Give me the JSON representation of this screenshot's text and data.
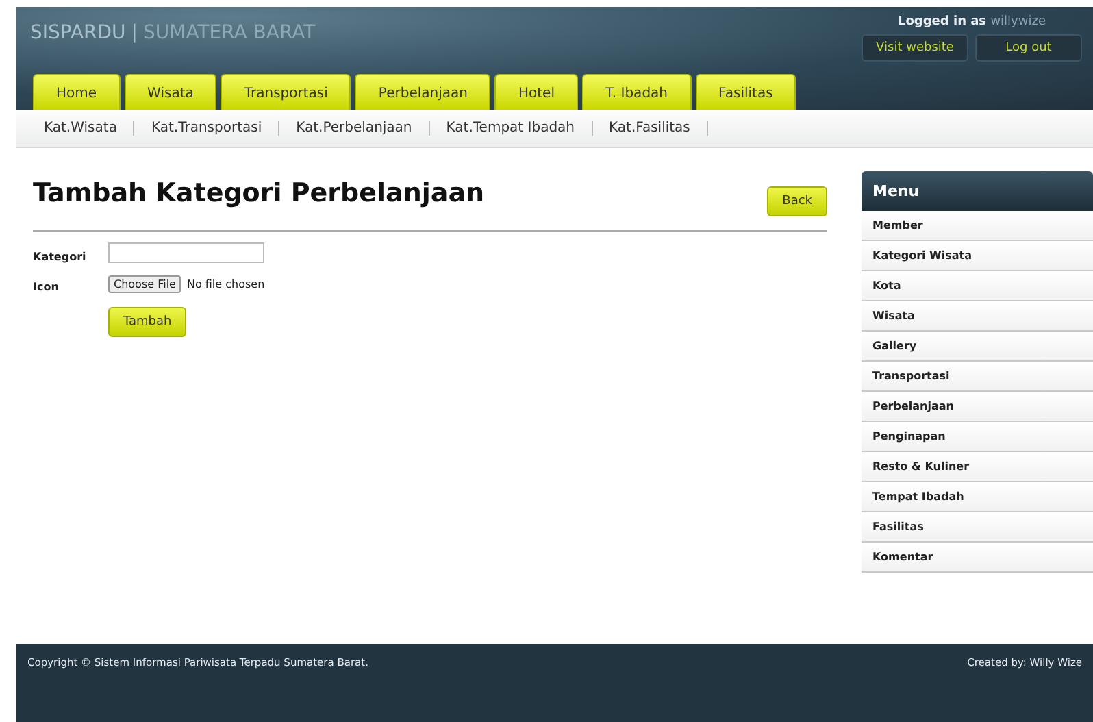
{
  "header": {
    "site_title": "SISPARDU",
    "title_divider": "|",
    "site_subtitle": "SUMATERA BARAT",
    "logged_in_label": "Logged in as",
    "username": "willywize",
    "buttons": [
      "Visit website",
      "Log out"
    ]
  },
  "tabs": [
    {
      "label": "Home",
      "selected": false
    },
    {
      "label": "Wisata",
      "selected": false
    },
    {
      "label": "Transportasi",
      "selected": false
    },
    {
      "label": "Perbelanjaan",
      "selected": false
    },
    {
      "label": "Hotel",
      "selected": false
    },
    {
      "label": "T. Ibadah",
      "selected": false
    },
    {
      "label": "Fasilitas",
      "selected": false
    }
  ],
  "subnav": [
    "Kat.Wisata",
    "Kat.Transportasi",
    "Kat.Perbelanjaan",
    "Kat.Tempat Ibadah",
    "Kat.Fasilitas"
  ],
  "page": {
    "title": "Tambah Kategori Perbelanjaan",
    "back_button": "Back"
  },
  "form": {
    "kategori_label": "Kategori",
    "icon_label": "Icon",
    "file_button": "Choose File",
    "file_status": "No file chosen",
    "submit": "Tambah"
  },
  "sidebar": {
    "title": "Menu",
    "items": [
      "Member",
      "Kategori Wisata",
      "Kota",
      "Wisata",
      "Gallery",
      "Transportasi",
      "Perbelanjaan",
      "Penginapan",
      "Resto & Kuliner",
      "Tempat Ibadah",
      "Fasilitas",
      "Komentar"
    ]
  },
  "footer": {
    "copyright": "Copyright © Sistem Informasi Pariwisata Terpadu Sumatera Barat.",
    "credit": "Created by: Willy Wize"
  }
}
